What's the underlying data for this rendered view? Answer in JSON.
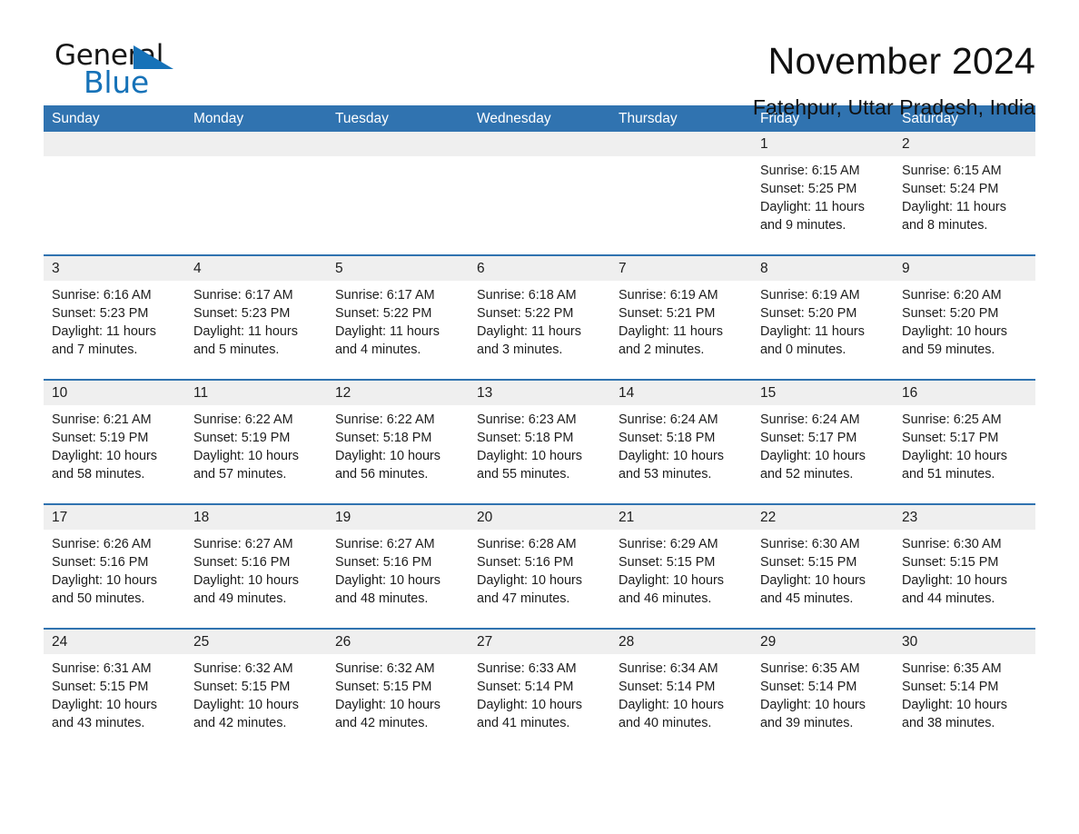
{
  "logo": {
    "text_top": "General",
    "text_bottom": "Blue",
    "triangle_color": "#1672b8"
  },
  "header": {
    "title": "November 2024",
    "location": "Fatehpur, Uttar Pradesh, India"
  },
  "colors": {
    "header_blue": "#3073b0",
    "day_band_gray": "#efefef",
    "text": "#1d1d1d",
    "brand_blue": "#1672b8"
  },
  "calendar": {
    "day_names": [
      "Sunday",
      "Monday",
      "Tuesday",
      "Wednesday",
      "Thursday",
      "Friday",
      "Saturday"
    ],
    "weeks": [
      [
        {
          "day": "",
          "lines": []
        },
        {
          "day": "",
          "lines": []
        },
        {
          "day": "",
          "lines": []
        },
        {
          "day": "",
          "lines": []
        },
        {
          "day": "",
          "lines": []
        },
        {
          "day": "1",
          "lines": [
            "Sunrise: 6:15 AM",
            "Sunset: 5:25 PM",
            "Daylight: 11 hours and 9 minutes."
          ]
        },
        {
          "day": "2",
          "lines": [
            "Sunrise: 6:15 AM",
            "Sunset: 5:24 PM",
            "Daylight: 11 hours and 8 minutes."
          ]
        }
      ],
      [
        {
          "day": "3",
          "lines": [
            "Sunrise: 6:16 AM",
            "Sunset: 5:23 PM",
            "Daylight: 11 hours and 7 minutes."
          ]
        },
        {
          "day": "4",
          "lines": [
            "Sunrise: 6:17 AM",
            "Sunset: 5:23 PM",
            "Daylight: 11 hours and 5 minutes."
          ]
        },
        {
          "day": "5",
          "lines": [
            "Sunrise: 6:17 AM",
            "Sunset: 5:22 PM",
            "Daylight: 11 hours and 4 minutes."
          ]
        },
        {
          "day": "6",
          "lines": [
            "Sunrise: 6:18 AM",
            "Sunset: 5:22 PM",
            "Daylight: 11 hours and 3 minutes."
          ]
        },
        {
          "day": "7",
          "lines": [
            "Sunrise: 6:19 AM",
            "Sunset: 5:21 PM",
            "Daylight: 11 hours and 2 minutes."
          ]
        },
        {
          "day": "8",
          "lines": [
            "Sunrise: 6:19 AM",
            "Sunset: 5:20 PM",
            "Daylight: 11 hours and 0 minutes."
          ]
        },
        {
          "day": "9",
          "lines": [
            "Sunrise: 6:20 AM",
            "Sunset: 5:20 PM",
            "Daylight: 10 hours and 59 minutes."
          ]
        }
      ],
      [
        {
          "day": "10",
          "lines": [
            "Sunrise: 6:21 AM",
            "Sunset: 5:19 PM",
            "Daylight: 10 hours and 58 minutes."
          ]
        },
        {
          "day": "11",
          "lines": [
            "Sunrise: 6:22 AM",
            "Sunset: 5:19 PM",
            "Daylight: 10 hours and 57 minutes."
          ]
        },
        {
          "day": "12",
          "lines": [
            "Sunrise: 6:22 AM",
            "Sunset: 5:18 PM",
            "Daylight: 10 hours and 56 minutes."
          ]
        },
        {
          "day": "13",
          "lines": [
            "Sunrise: 6:23 AM",
            "Sunset: 5:18 PM",
            "Daylight: 10 hours and 55 minutes."
          ]
        },
        {
          "day": "14",
          "lines": [
            "Sunrise: 6:24 AM",
            "Sunset: 5:18 PM",
            "Daylight: 10 hours and 53 minutes."
          ]
        },
        {
          "day": "15",
          "lines": [
            "Sunrise: 6:24 AM",
            "Sunset: 5:17 PM",
            "Daylight: 10 hours and 52 minutes."
          ]
        },
        {
          "day": "16",
          "lines": [
            "Sunrise: 6:25 AM",
            "Sunset: 5:17 PM",
            "Daylight: 10 hours and 51 minutes."
          ]
        }
      ],
      [
        {
          "day": "17",
          "lines": [
            "Sunrise: 6:26 AM",
            "Sunset: 5:16 PM",
            "Daylight: 10 hours and 50 minutes."
          ]
        },
        {
          "day": "18",
          "lines": [
            "Sunrise: 6:27 AM",
            "Sunset: 5:16 PM",
            "Daylight: 10 hours and 49 minutes."
          ]
        },
        {
          "day": "19",
          "lines": [
            "Sunrise: 6:27 AM",
            "Sunset: 5:16 PM",
            "Daylight: 10 hours and 48 minutes."
          ]
        },
        {
          "day": "20",
          "lines": [
            "Sunrise: 6:28 AM",
            "Sunset: 5:16 PM",
            "Daylight: 10 hours and 47 minutes."
          ]
        },
        {
          "day": "21",
          "lines": [
            "Sunrise: 6:29 AM",
            "Sunset: 5:15 PM",
            "Daylight: 10 hours and 46 minutes."
          ]
        },
        {
          "day": "22",
          "lines": [
            "Sunrise: 6:30 AM",
            "Sunset: 5:15 PM",
            "Daylight: 10 hours and 45 minutes."
          ]
        },
        {
          "day": "23",
          "lines": [
            "Sunrise: 6:30 AM",
            "Sunset: 5:15 PM",
            "Daylight: 10 hours and 44 minutes."
          ]
        }
      ],
      [
        {
          "day": "24",
          "lines": [
            "Sunrise: 6:31 AM",
            "Sunset: 5:15 PM",
            "Daylight: 10 hours and 43 minutes."
          ]
        },
        {
          "day": "25",
          "lines": [
            "Sunrise: 6:32 AM",
            "Sunset: 5:15 PM",
            "Daylight: 10 hours and 42 minutes."
          ]
        },
        {
          "day": "26",
          "lines": [
            "Sunrise: 6:32 AM",
            "Sunset: 5:15 PM",
            "Daylight: 10 hours and 42 minutes."
          ]
        },
        {
          "day": "27",
          "lines": [
            "Sunrise: 6:33 AM",
            "Sunset: 5:14 PM",
            "Daylight: 10 hours and 41 minutes."
          ]
        },
        {
          "day": "28",
          "lines": [
            "Sunrise: 6:34 AM",
            "Sunset: 5:14 PM",
            "Daylight: 10 hours and 40 minutes."
          ]
        },
        {
          "day": "29",
          "lines": [
            "Sunrise: 6:35 AM",
            "Sunset: 5:14 PM",
            "Daylight: 10 hours and 39 minutes."
          ]
        },
        {
          "day": "30",
          "lines": [
            "Sunrise: 6:35 AM",
            "Sunset: 5:14 PM",
            "Daylight: 10 hours and 38 minutes."
          ]
        }
      ]
    ]
  }
}
